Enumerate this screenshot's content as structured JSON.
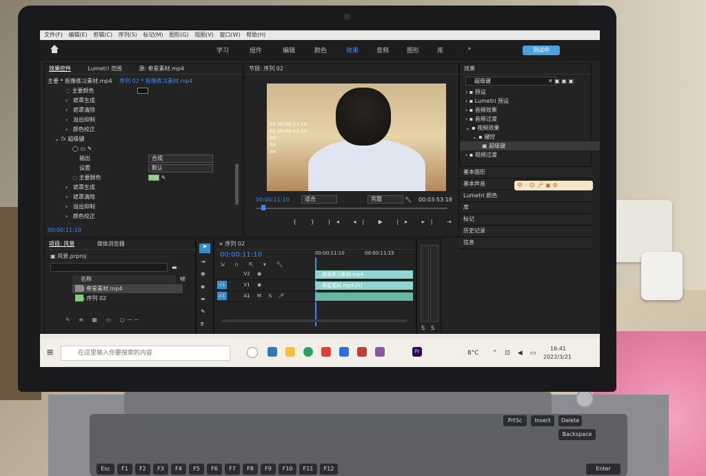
{
  "menu": [
    "文件(F)",
    "编辑(E)",
    "剪辑(C)",
    "序列(S)",
    "标记(M)",
    "图形(G)",
    "视图(V)",
    "窗口(W)",
    "帮助(H)"
  ],
  "workspaces": [
    "学习",
    "组件",
    "编辑",
    "颜色",
    "效果",
    "音频",
    "图形",
    "库"
  ],
  "active_workspace": "效果",
  "cloud_button": "测试中",
  "effect_controls": {
    "tabs": [
      "效果控件",
      "Lumetri 范围",
      "源: 牵星素材.mp4"
    ],
    "clip_path": "主要 * 抠像练习素材.mp4",
    "clip_path_active": "序列 02 * 抠像练习素材.mp4",
    "rows_top": [
      "主要颜色",
      "遮罩生成",
      "遮罩清除",
      "溢出抑制",
      "颜色校正"
    ],
    "fx_title": "超级键",
    "output_label": "输出",
    "output_value": "合成",
    "setting_label": "设置",
    "setting_value": "默认",
    "rows_bottom": [
      "主要颜色",
      "遮罩生成",
      "遮罩清除",
      "溢出抑制",
      "颜色校正"
    ],
    "timecode": "00:00:11:10"
  },
  "program": {
    "title": "节目: 序列 02",
    "timecode_left": "00:00:11:10",
    "fit": "适合",
    "quality": "完整",
    "timecode_right": "00:03:53:18",
    "overlay": [
      "V1 00:00:11:10",
      "A1 00:00:11:10",
      "A2",
      "A3",
      "A4"
    ]
  },
  "project": {
    "tabs": [
      "项目: 风景",
      "媒体浏览器"
    ],
    "filename": "风景.prproj",
    "col_name": "名称",
    "col_frame": "帧",
    "items": [
      "牵星素材.mp4",
      "序列 02"
    ]
  },
  "timeline": {
    "title": "序列 02",
    "timecode": "00:00:11:10",
    "ruler": [
      "00:00:11:10",
      "00:00:11:15"
    ],
    "tracks": [
      {
        "name": "V2",
        "clip": "抠像练习素材.mp4"
      },
      {
        "name": "V1",
        "clip": "牵星素材.mp4 [V]"
      },
      {
        "name": "A1",
        "clip": ""
      }
    ]
  },
  "meter_labels": [
    "S",
    "S"
  ],
  "effects_panel": {
    "title": "效果",
    "search_value": "超级键",
    "tree": [
      "预设",
      "Lumetri 预设",
      "音频效果",
      "音频过渡",
      "视频效果",
      "键控",
      "超级键",
      "视频过渡"
    ],
    "sections": [
      "基本图形",
      "基本声音",
      "Lumetri 颜色",
      "库",
      "标记",
      "历史记录",
      "信息"
    ]
  },
  "system": {
    "search_placeholder": "在这里输入你要搜索的内容",
    "weather": "8°C",
    "time": "16:41",
    "date": "2022/3/21"
  },
  "keyboard": [
    "Esc",
    "F1",
    "F2",
    "F3",
    "F4",
    "F5",
    "F6",
    "F7",
    "F8",
    "F9",
    "F10",
    "F11",
    "F12",
    "PrtSc",
    "Insert",
    "Delete",
    "Backspace",
    "Enter"
  ],
  "colors": {
    "accent": "#3d8cf5",
    "clip_v": "#8fd6d1",
    "clip_a": "#67b7a5",
    "track_on": "#2f8fd0"
  }
}
